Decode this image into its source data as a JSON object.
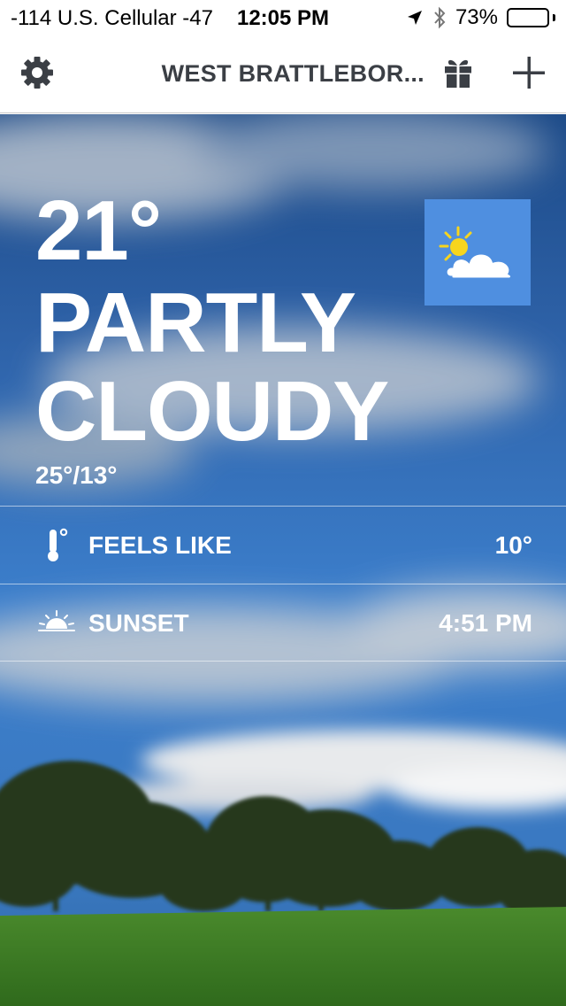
{
  "status_bar": {
    "carrier": "-114 U.S. Cellular  -47",
    "time": "12:05 PM",
    "battery_percent_label": "73%",
    "battery_level": 0.73,
    "icons": [
      "location-arrow-icon",
      "bluetooth-icon",
      "battery-icon"
    ]
  },
  "nav": {
    "location": "WEST BRATTLEBOR...",
    "icons": [
      "gear-icon",
      "gift-icon",
      "plus-icon"
    ]
  },
  "weather": {
    "temperature": "21°",
    "condition_line1": "PARTLY",
    "condition_line2": "CLOUDY",
    "high_low": "25°/13°",
    "condition_icon": "partly-cloudy-icon",
    "icon_tile_color": "#4f8fe0"
  },
  "details": [
    {
      "icon": "thermometer-icon",
      "label": "FEELS LIKE",
      "value": "10°"
    },
    {
      "icon": "sunset-icon",
      "label": "SUNSET",
      "value": "4:51 PM"
    }
  ],
  "colors": {
    "sky_top": "#1f4f8f",
    "sky_mid": "#3a78c4",
    "grass": "#3f7d2a",
    "text": "#ffffff",
    "nav_text": "#3b3f45"
  }
}
